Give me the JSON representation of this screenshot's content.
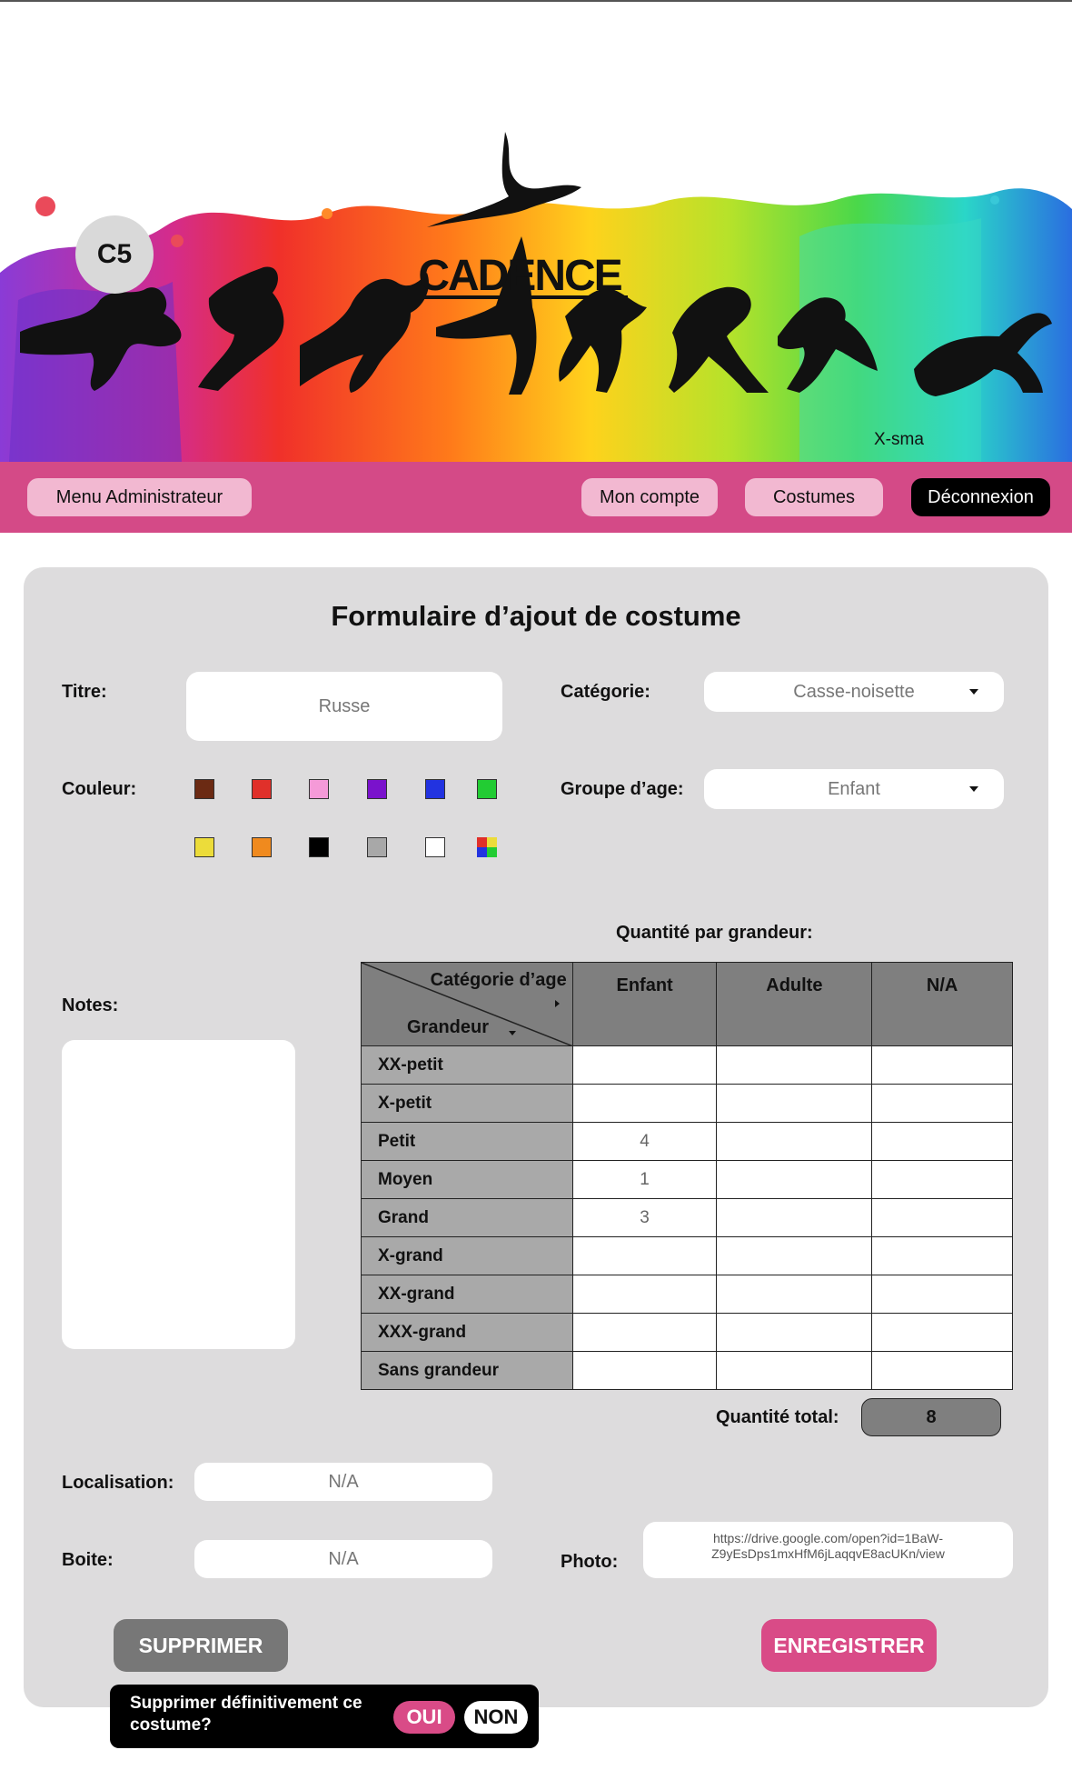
{
  "header": {
    "badge": "C5",
    "logo_text": "CADENCE",
    "banner_caption": "X-sma"
  },
  "nav": {
    "admin_menu": "Menu Administrateur",
    "my_account": "Mon compte",
    "costumes": "Costumes",
    "logout": "Déconnexion"
  },
  "form": {
    "title": "Formulaire d’ajout de costume",
    "titre_label": "Titre:",
    "titre_value": "Russe",
    "categorie_label": "Catégorie:",
    "categorie_value": "Casse-noisette",
    "couleur_label": "Couleur:",
    "colors": [
      "#6b2a13",
      "#e0302a",
      "#f59ad8",
      "#7a12cc",
      "#2233e0",
      "#22cc33",
      "#ecdc3a",
      "#f08a1e",
      "#000000",
      "#a8a8a8",
      "#ffffff",
      "multicolor"
    ],
    "groupe_label": "Groupe d’age:",
    "groupe_value": "Enfant",
    "notes_label": "Notes:",
    "notes_value": "",
    "quantite_label": "Quantité par grandeur:",
    "table": {
      "corner_top": "Catégorie d’age",
      "corner_bottom": "Grandeur",
      "columns": [
        "Enfant",
        "Adulte",
        "N/A"
      ],
      "rows": [
        {
          "label": "XX-petit",
          "values": [
            "",
            "",
            ""
          ]
        },
        {
          "label": "X-petit",
          "values": [
            "",
            "",
            ""
          ]
        },
        {
          "label": "Petit",
          "values": [
            "4",
            "",
            ""
          ]
        },
        {
          "label": "Moyen",
          "values": [
            "1",
            "",
            ""
          ]
        },
        {
          "label": "Grand",
          "values": [
            "3",
            "",
            ""
          ]
        },
        {
          "label": "X-grand",
          "values": [
            "",
            "",
            ""
          ]
        },
        {
          "label": "XX-grand",
          "values": [
            "",
            "",
            ""
          ]
        },
        {
          "label": "XXX-grand",
          "values": [
            "",
            "",
            ""
          ]
        },
        {
          "label": "Sans grandeur",
          "values": [
            "",
            "",
            ""
          ]
        }
      ]
    },
    "total_label": "Quantité total:",
    "total_value": "8",
    "localisation_label": "Localisation:",
    "localisation_value": "N/A",
    "boite_label": "Boite:",
    "boite_value": "N/A",
    "photo_label": "Photo:",
    "photo_value": "https://drive.google.com/open?id=1BaW-Z9yEsDps1mxHfM6jLaqqvE8acUKn/view",
    "delete_button": "SUPPRIMER",
    "save_button": "ENREGISTRER"
  },
  "confirm_dialog": {
    "message": "Supprimer définitivement ce costume?",
    "yes": "OUI",
    "no": "NON"
  }
}
